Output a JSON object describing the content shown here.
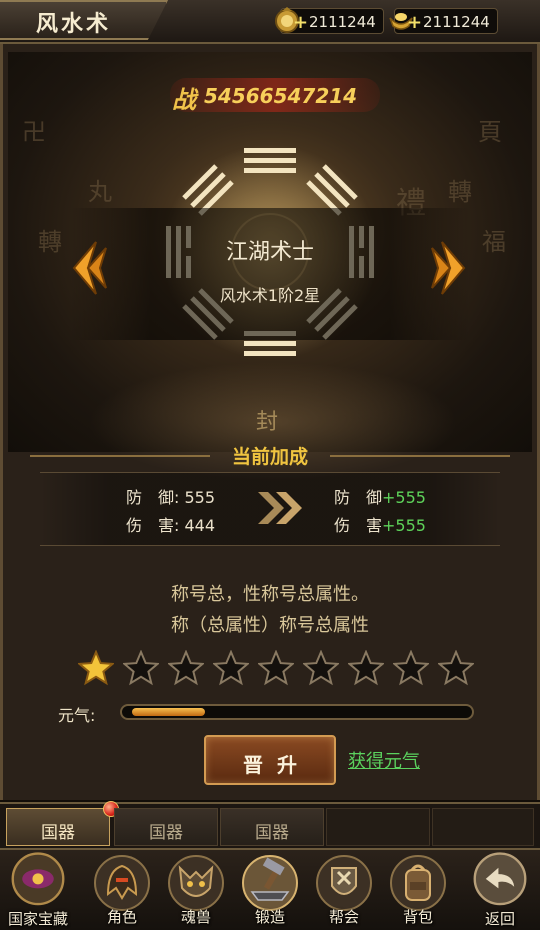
{
  "header": {
    "title": "风水术",
    "currencies": [
      {
        "icon": "coin-bag-icon",
        "value": "2111244"
      },
      {
        "icon": "gold-ingot-icon",
        "value": "2111244"
      }
    ]
  },
  "power": {
    "label": "战",
    "value": "54566547214"
  },
  "scene": {
    "class_name": "江湖术士",
    "level_text": "风水术1阶2星",
    "center_glyph": "封"
  },
  "bonus": {
    "title": "当前加成",
    "current": [
      {
        "label": "防　御:",
        "value": "555"
      },
      {
        "label": "伤　害:",
        "value": "444"
      }
    ],
    "next": [
      {
        "label": "防　御",
        "plus": "+555"
      },
      {
        "label": "伤　害",
        "plus": "+555"
      }
    ]
  },
  "description": [
    "称号总，性称号总属性。",
    "称（总属性）称号总属性"
  ],
  "stars": {
    "filled": 1,
    "total": 9
  },
  "vitality": {
    "label": "元气:",
    "progress": 0.22
  },
  "actions": {
    "promote_label": "晋升",
    "get_vitality_label": "获得元气"
  },
  "tabs": [
    {
      "label": "国器",
      "active": true,
      "badge": true
    },
    {
      "label": "国器",
      "active": false
    },
    {
      "label": "国器",
      "active": false
    }
  ],
  "bottom_nav": {
    "left": {
      "label": "国家宝藏",
      "icon": "treasure-eye-icon"
    },
    "items": [
      {
        "label": "角色",
        "icon": "armor-helmet-icon"
      },
      {
        "label": "魂兽",
        "icon": "beast-skull-icon"
      },
      {
        "label": "锻造",
        "icon": "anvil-hammer-icon",
        "active": true
      },
      {
        "label": "帮会",
        "icon": "guild-crest-icon"
      },
      {
        "label": "背包",
        "icon": "backpack-icon"
      }
    ],
    "right": {
      "label": "返回",
      "icon": "return-arrow-icon"
    }
  },
  "colors": {
    "accent_gold": "#f0c440",
    "plus_green": "#5ed35a",
    "frame": "#6b5a3c"
  }
}
